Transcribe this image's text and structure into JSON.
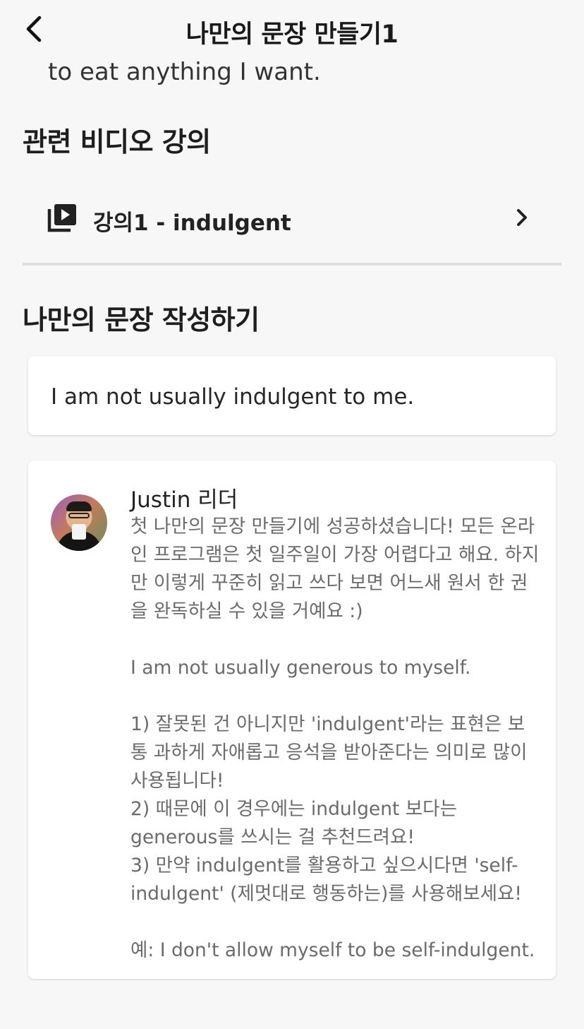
{
  "header": {
    "title": "나만의 문장 만들기1"
  },
  "previous_text": "to eat anything I want.",
  "related_videos": {
    "title": "관련 비디오 강의",
    "items": [
      {
        "label": "강의1 - indulgent"
      }
    ]
  },
  "write_section": {
    "title": "나만의 문장 작성하기",
    "sentence": "I am not usually indulgent to me."
  },
  "feedback": {
    "author": "Justin 리더",
    "paragraphs": [
      "첫 나만의 문장 만들기에 성공하셨습니다! 모든 온라인 프로그램은 첫 일주일이 가장 어렵다고 해요. 하지만 이렇게 꾸준히 읽고 쓰다 보면 어느새 원서 한 권을 완독하실 수 있을 거예요 :)",
      "I am not usually generous to myself.",
      "1) 잘못된 건 아니지만 'indulgent'라는 표현은 보통 과하게 자애롭고 응석을 받아준다는 의미로 많이 사용됩니다!\n2) 때문에 이 경우에는 indulgent 보다는 generous를 쓰시는 걸 추천드려요!\n3) 만약 indulgent를 활용하고 싶으시다면 'self-indulgent' (제멋대로 행동하는)를 사용해보세요!",
      "예: I don't allow myself to be self-indulgent."
    ]
  },
  "colors": {
    "background": "#f7f7f7",
    "card": "#ffffff",
    "divider": "#dedede",
    "feedback_text": "#6b6b6b"
  },
  "icons": {
    "back": "chevron-left-icon",
    "video": "video-library-icon",
    "forward": "chevron-right-icon"
  }
}
